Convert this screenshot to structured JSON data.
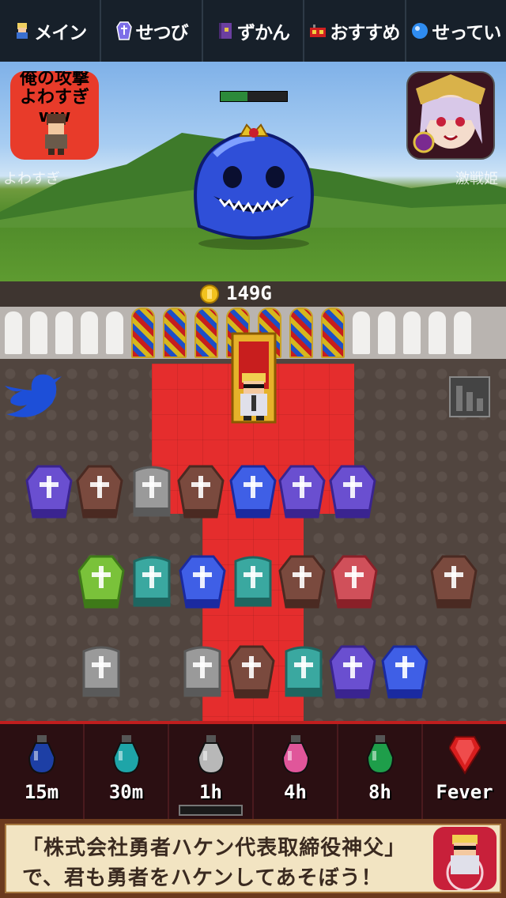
{
  "nav": {
    "tabs": [
      {
        "label": "メイン",
        "icon": "hero-icon"
      },
      {
        "label": "せつび",
        "icon": "coffin-icon"
      },
      {
        "label": "ずかん",
        "icon": "book-icon"
      },
      {
        "label": "おすすめ",
        "icon": "gift-icon"
      },
      {
        "label": "せってい",
        "icon": "gear-orb-icon"
      }
    ]
  },
  "battle": {
    "enemy_hp": 0.4,
    "ad_left": {
      "line1": "俺の攻撃",
      "line2": "よわすぎww"
    },
    "ghost_left": "よわすぎ",
    "ghost_right": "激戦姫"
  },
  "castle": {
    "gold": "149G",
    "twitter_icon": "twitter-bird-icon",
    "ranking_icon": "ranking-icon",
    "rows": [
      [
        "purple",
        "brown",
        "gray-stone",
        "brown",
        "blue",
        "purple",
        "purple"
      ],
      [
        "green",
        "teal-stone",
        "blue",
        "teal-stone",
        "brown",
        "red",
        "brown"
      ],
      [
        "gray-stone",
        "gray-stone",
        "brown",
        "teal-stone",
        "purple",
        "blue"
      ]
    ]
  },
  "potions": [
    {
      "label": "15m",
      "color": "#1d3fa5"
    },
    {
      "label": "30m",
      "color": "#1ea5a8"
    },
    {
      "label": "1h",
      "color": "#b8b8b8"
    },
    {
      "label": "4h",
      "color": "#e0569a"
    },
    {
      "label": "8h",
      "color": "#1e9e4a"
    },
    {
      "label": "Fever",
      "color": "#d81e1e"
    }
  ],
  "selected_potion": "1h",
  "banner": {
    "line1": "「株式会社勇者ハケン代表取締役神父」",
    "line2": "で、君も勇者をハケンしてあそぼう！"
  }
}
